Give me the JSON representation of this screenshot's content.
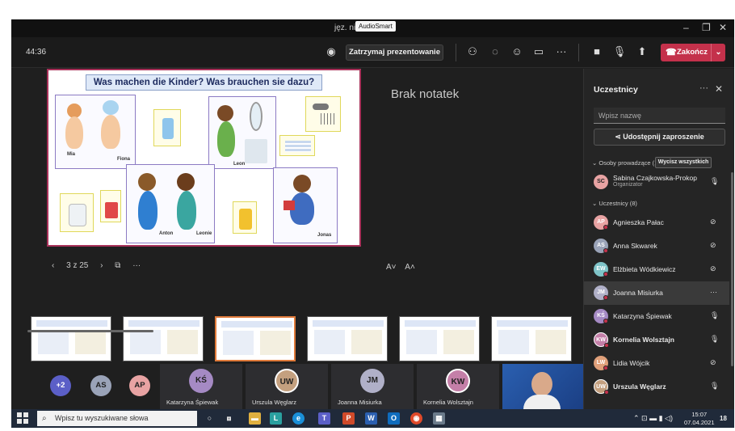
{
  "window": {
    "title": "jęz. niemiecki 5",
    "tooltip": "AudioSmart",
    "controls": {
      "minimize": "–",
      "restore": "❐",
      "close": "✕"
    }
  },
  "toolbar": {
    "timer": "44:36",
    "stop_presenting": "Zatrzymaj prezentowanie",
    "end_call": "Zakończ",
    "more": "···"
  },
  "slide": {
    "title": "Was machen die Kinder? Was brauchen sie dazu?",
    "labels": [
      "Mia",
      "Fiona",
      "Leon",
      "Anton",
      "Leonie",
      "Jonas"
    ]
  },
  "notes": {
    "empty_text": "Brak notatek"
  },
  "slide_nav": {
    "position": "3 z 25",
    "more": "···",
    "font_decrease": "A˅",
    "font_increase": "A˄"
  },
  "thumbnails": [
    "1",
    "2",
    "3",
    "4",
    "5",
    "6"
  ],
  "strip": {
    "overflow_count": "+2",
    "avatars": [
      "AS",
      "AP"
    ],
    "tiles": [
      {
        "initials": "KŚ",
        "name": "Katarzyna Śpiewak"
      },
      {
        "initials": "UW",
        "name": "Urszula Węglarz"
      },
      {
        "initials": "JM",
        "name": "Joanna Misiurka"
      },
      {
        "initials": "KW",
        "name": "Kornelia Wolsztajn"
      }
    ]
  },
  "participants": {
    "header": "Uczestnicy",
    "search_placeholder": "Wpisz nazwę",
    "share_invite": "Udostępnij zaproszenie",
    "presenters_section": "Osoby prowadzące (1)",
    "mute_all": "Wycisz wszystkich",
    "attendees_section": "Uczestnicy (8)",
    "organizer": {
      "initials": "SC",
      "name": "Sabina Czajkowska-Prokop",
      "role": "Organizator"
    },
    "list": [
      {
        "initials": "AP",
        "name": "Agnieszka Pałac",
        "color": "#e8a3a3"
      },
      {
        "initials": "AS",
        "name": "Anna Skwarek",
        "color": "#9aa3b8"
      },
      {
        "initials": "EW",
        "name": "Elżbieta Wódkiewicz",
        "color": "#7fc4c8"
      },
      {
        "initials": "JM",
        "name": "Joanna Misiurka",
        "color": "#b0b0c8"
      },
      {
        "initials": "KŚ",
        "name": "Katarzyna Śpiewak",
        "color": "#a58ac4"
      },
      {
        "initials": "KW",
        "name": "Kornelia Wolsztajn",
        "color": "#c47fa8"
      },
      {
        "initials": "LW",
        "name": "Lidia Wójcik",
        "color": "#e0a07a"
      },
      {
        "initials": "UW",
        "name": "Urszula Węglarz",
        "color": "#c4a07f"
      }
    ]
  },
  "taskbar": {
    "search_placeholder": "Wpisz tu wyszukiwane słowa",
    "time": "15:07",
    "date": "07.04.2021",
    "notifications": "18"
  },
  "colors": {
    "end_call": "#c4314b",
    "slide_border": "#a8325a",
    "accent_thumb": "#e07a3a"
  }
}
